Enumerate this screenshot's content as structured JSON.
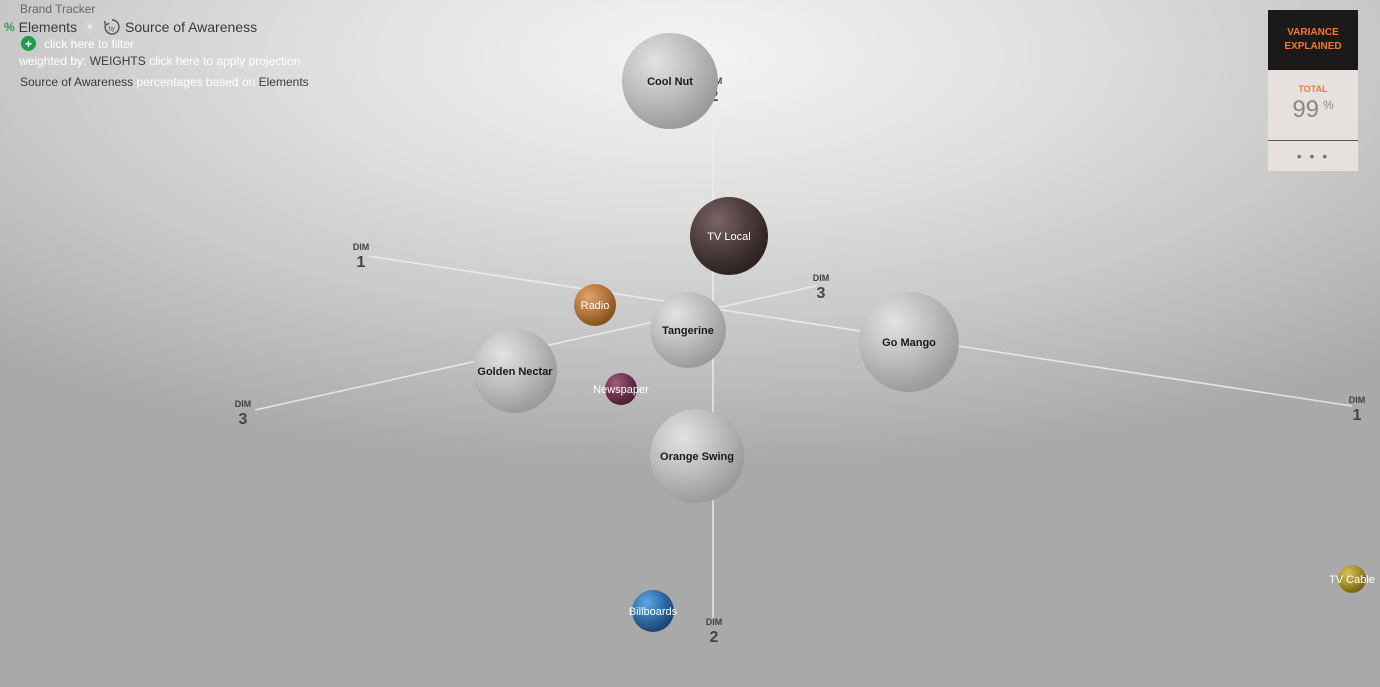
{
  "header": {
    "app_title": "Brand Tracker",
    "breadcrumb_icon": "%",
    "row_variable": "Elements",
    "close_glyph": "×",
    "column_variable": "Source of Awareness",
    "filter_prompt": "click here to filter",
    "weighted_by_label": "weighted by:",
    "weight_variable": "WEIGHTS",
    "projection_prompt": "click here to apply projection",
    "percent_base_variable": "Source of Awareness",
    "percent_base_text": "percentages based on",
    "percent_base_target": "Elements"
  },
  "variance_panel": {
    "title_line1": "VARIANCE",
    "title_line2": "EXPLAINED",
    "total_label": "TOTAL",
    "total_value": "99",
    "total_unit": "%",
    "more_glyph": "• • •"
  },
  "axes": [
    {
      "id": "dim1-left",
      "label_small": "DIM",
      "label_big": "1"
    },
    {
      "id": "dim1-right",
      "label_small": "DIM",
      "label_big": "1"
    },
    {
      "id": "dim2-top",
      "label_small": "DIM",
      "label_big": "2"
    },
    {
      "id": "dim2-bottom",
      "label_small": "DIM",
      "label_big": "2"
    },
    {
      "id": "dim3-left",
      "label_small": "DIM",
      "label_big": "3"
    },
    {
      "id": "dim3-right",
      "label_small": "DIM",
      "label_big": "3"
    }
  ],
  "bubbles": [
    {
      "label": "Cool Nut",
      "group": "element",
      "color": "#b9b9b9"
    },
    {
      "label": "TV Local",
      "group": "source",
      "color": "#4a3a3a"
    },
    {
      "label": "Radio",
      "group": "source",
      "color": "#b0753a"
    },
    {
      "label": "Tangerine",
      "group": "element",
      "color": "#b9b9b9"
    },
    {
      "label": "Go Mango",
      "group": "element",
      "color": "#b9b9b9"
    },
    {
      "label": "Golden Nectar",
      "group": "element",
      "color": "#b9b9b9"
    },
    {
      "label": "Newspaper",
      "group": "source",
      "color": "#6e3450"
    },
    {
      "label": "Orange Swing",
      "group": "element",
      "color": "#b9b9b9"
    },
    {
      "label": "Billboards",
      "group": "source",
      "color": "#2f6aa3"
    },
    {
      "label": "TV Cable",
      "group": "source",
      "color": "#a48f2a"
    }
  ]
}
